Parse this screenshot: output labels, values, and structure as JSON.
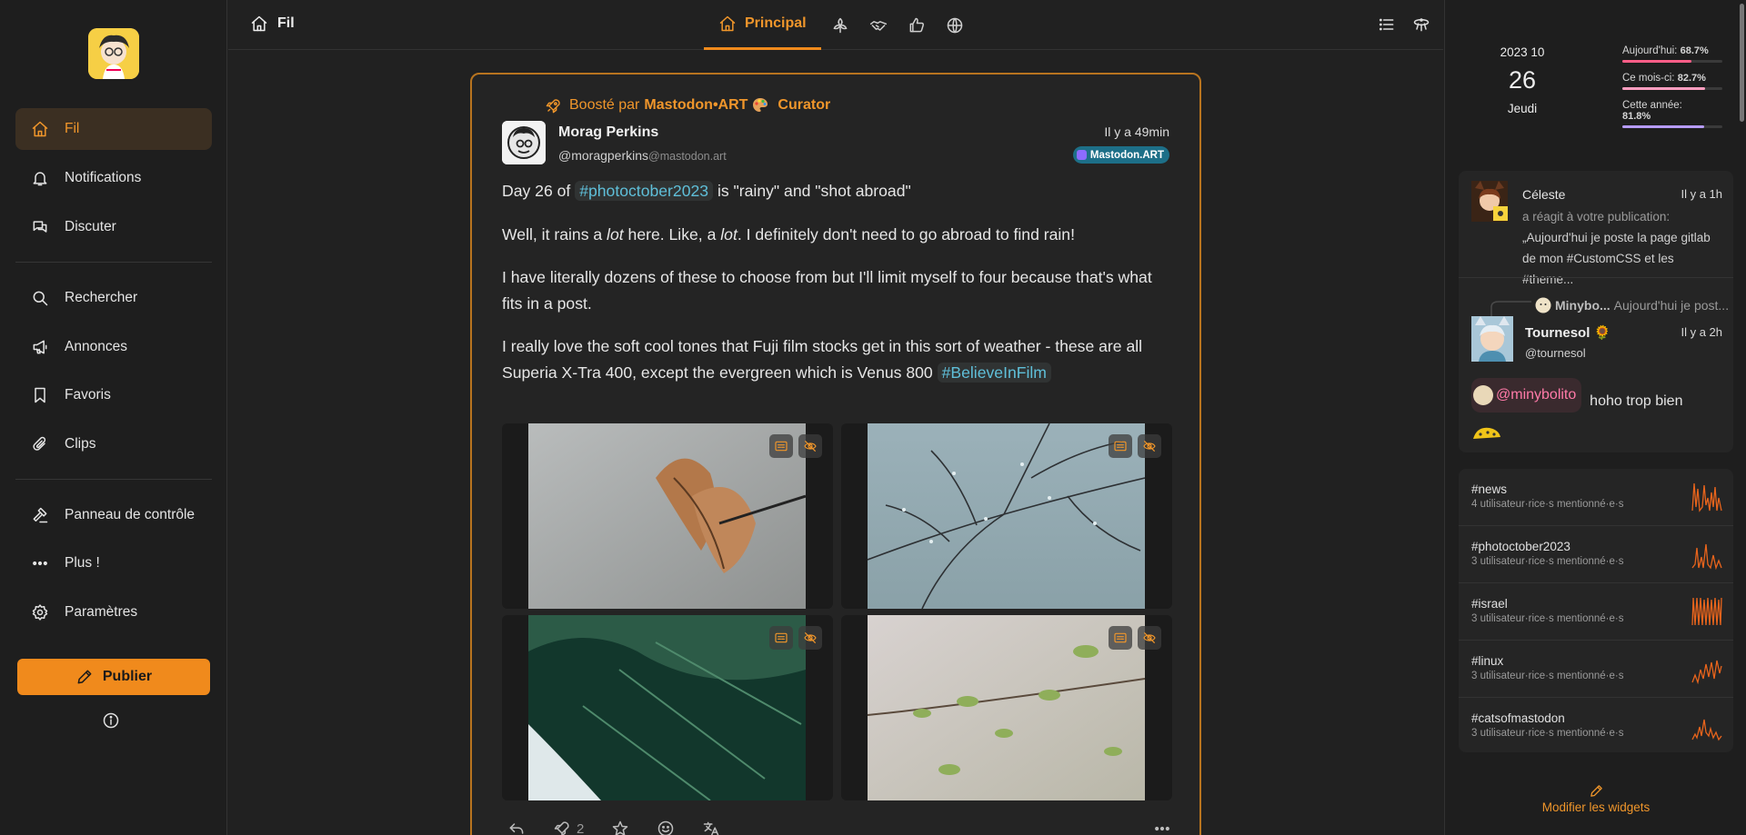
{
  "sidebar": {
    "items": [
      {
        "label": "Fil",
        "icon": "home-icon",
        "active": true
      },
      {
        "label": "Notifications",
        "icon": "bell-icon"
      },
      {
        "label": "Discuter",
        "icon": "chat-icon"
      },
      {
        "label": "Rechercher",
        "icon": "search-icon"
      },
      {
        "label": "Annonces",
        "icon": "megaphone-icon"
      },
      {
        "label": "Favoris",
        "icon": "bookmark-icon"
      },
      {
        "label": "Clips",
        "icon": "paperclip-icon"
      },
      {
        "label": "Panneau de contrôle",
        "icon": "gavel-icon"
      },
      {
        "label": "Plus !",
        "icon": "dots-icon"
      },
      {
        "label": "Paramètres",
        "icon": "gear-icon"
      }
    ],
    "publish_label": "Publier"
  },
  "header": {
    "title": "Fil",
    "active_tab": "Principal",
    "tab_icons": [
      "home-icon",
      "planet-icon",
      "handshake-icon",
      "thumbs-up-icon",
      "globe-icon"
    ]
  },
  "post": {
    "boosted_prefix": "Boosté par",
    "booster_name": "Mastodon•ART",
    "booster_suffix": "Curator",
    "author_name": "Morag Perkins",
    "author_handle": "@moragperkins",
    "author_host": "@mastodon.art",
    "time": "Il y a 49min",
    "instance": "Mastodon.ART",
    "line1_pre": "Day 26 of",
    "line1_tag": "#photoctober2023",
    "line1_post": "is \"rainy\" and  \"shot abroad\"",
    "p2_a": "Well, it rains a ",
    "p2_b": "lot",
    "p2_c": " here. Like, a ",
    "p2_d": "lot",
    "p2_e": ". I definitely don't need to go abroad to find rain!",
    "p3": "I have literally dozens of these to choose from but I'll limit myself to four because that's what fits in a post.",
    "p4": "I really love the soft cool tones that Fuji film stocks get in this sort of weather - these are all Superia X-Tra 400, except the evergreen which is Venus 800",
    "p4_tag": "#BelieveInFilm",
    "renote_count": "2"
  },
  "widgets": {
    "calendar": {
      "year_month": "2023  10",
      "day": "26",
      "weekday": "Jeudi"
    },
    "progress": [
      {
        "label": "Aujourd'hui:",
        "value": "68.7%",
        "fraction": 0.687,
        "color": "#ff5d87"
      },
      {
        "label": "Ce mois-ci:",
        "value": "82.7%",
        "fraction": 0.827,
        "color": "#ff9ec0"
      },
      {
        "label": "Cette année:",
        "value": "81.8%",
        "fraction": 0.818,
        "color": "#b79cff"
      }
    ],
    "notif1": {
      "name": "Céleste",
      "time": "Il y a 1h",
      "action": "a réagit à votre publication: ",
      "quote": "„Aujourd'hui je poste la page gitlab de mon #CustomCSS et les #theme..."
    },
    "notif2": {
      "reply_to": "Minybo...",
      "reply_text": "Aujourd'hui je post...",
      "name": "Tournesol",
      "handle": "@tournesol",
      "time": "Il y a 2h",
      "mention": "@minybolito",
      "text": "hoho trop bien"
    },
    "trends": [
      {
        "tag": "#news",
        "sub": "4 utilisateur·rice·s mentionné·e·s"
      },
      {
        "tag": "#photoctober2023",
        "sub": "3 utilisateur·rice·s mentionné·e·s"
      },
      {
        "tag": "#israel",
        "sub": "3 utilisateur·rice·s mentionné·e·s"
      },
      {
        "tag": "#linux",
        "sub": "3 utilisateur·rice·s mentionné·e·s"
      },
      {
        "tag": "#catsofmastodon",
        "sub": "3 utilisateur·rice·s mentionné·e·s"
      }
    ],
    "edit_label": "Modifier les widgets"
  },
  "colors": {
    "accent": "#f08a1c",
    "hashtag": "#5fbfd9",
    "sparkline": "#e8641c"
  }
}
